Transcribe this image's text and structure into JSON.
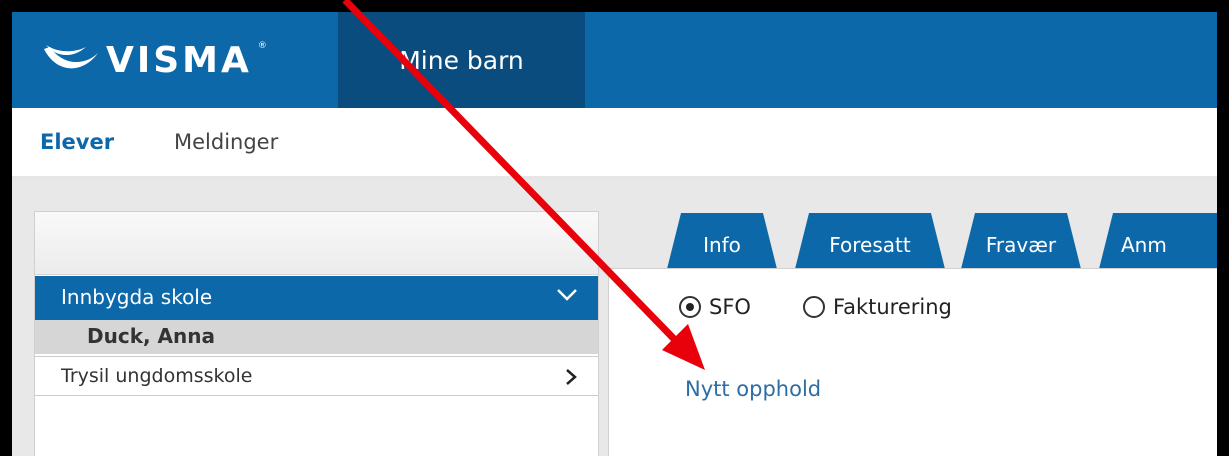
{
  "header": {
    "logo_text": "VISMA",
    "logo_reg": "®",
    "active_nav": "Mine barn"
  },
  "subnav": {
    "items": [
      "Elever",
      "Meldinger"
    ]
  },
  "left_panel": {
    "active_school": "Innbygda skole",
    "student": "Duck, Anna",
    "other_school": "Trysil ungdomsskole"
  },
  "tabs": [
    "Info",
    "Foresatt",
    "Fravær",
    "Anm"
  ],
  "radios": [
    {
      "label": "SFO",
      "checked": true
    },
    {
      "label": "Fakturering",
      "checked": false
    }
  ],
  "link": "Nytt opphold",
  "colors": {
    "brand_blue": "#0d68a9",
    "nav_active": "#0a4c7d",
    "arrow_red": "#e8000b"
  },
  "icons": {
    "logo_mark": "visma-swoosh-icon",
    "expand": "chevron-down-icon",
    "collapse": "chevron-right-icon"
  }
}
